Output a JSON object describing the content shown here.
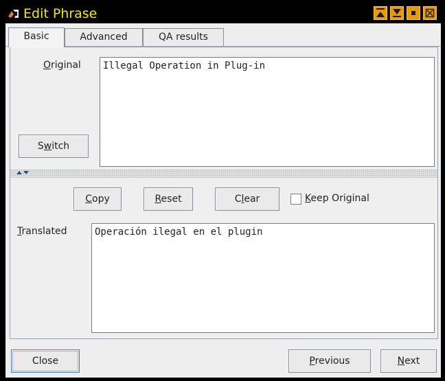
{
  "window": {
    "title": "Edit Phrase",
    "controls": [
      "minimize-icon",
      "restore-icon",
      "shade-icon",
      "close-icon"
    ]
  },
  "tabs": [
    {
      "label": "Basic",
      "active": true
    },
    {
      "label": "Advanced",
      "active": false
    },
    {
      "label": "QA results",
      "active": false
    }
  ],
  "original": {
    "label_mnemonic": "O",
    "label_rest": "riginal",
    "value": "Illegal Operation in Plug-in"
  },
  "switch_button": {
    "pre": "S",
    "mnemonic": "w",
    "post": "itch"
  },
  "actions": {
    "copy": {
      "pre": "",
      "mnemonic": "C",
      "post": "opy"
    },
    "reset": {
      "pre": "",
      "mnemonic": "R",
      "post": "eset"
    },
    "clear": {
      "pre": "C",
      "mnemonic": "l",
      "post": "ear"
    },
    "keep_original": {
      "pre": "",
      "mnemonic": "K",
      "post": "eep Original",
      "checked": false
    }
  },
  "translated": {
    "label_mnemonic": "T",
    "label_rest": "ranslated",
    "value": "Operación ilegal en el plugin"
  },
  "footer": {
    "close": "Close",
    "previous": {
      "pre": "",
      "mnemonic": "P",
      "post": "revious"
    },
    "next": {
      "pre": "",
      "mnemonic": "N",
      "post": "ext"
    }
  },
  "colors": {
    "title_text": "#f2e61a",
    "title_buttons": "#e89a0a",
    "accent_border": "#8ea5bd"
  }
}
